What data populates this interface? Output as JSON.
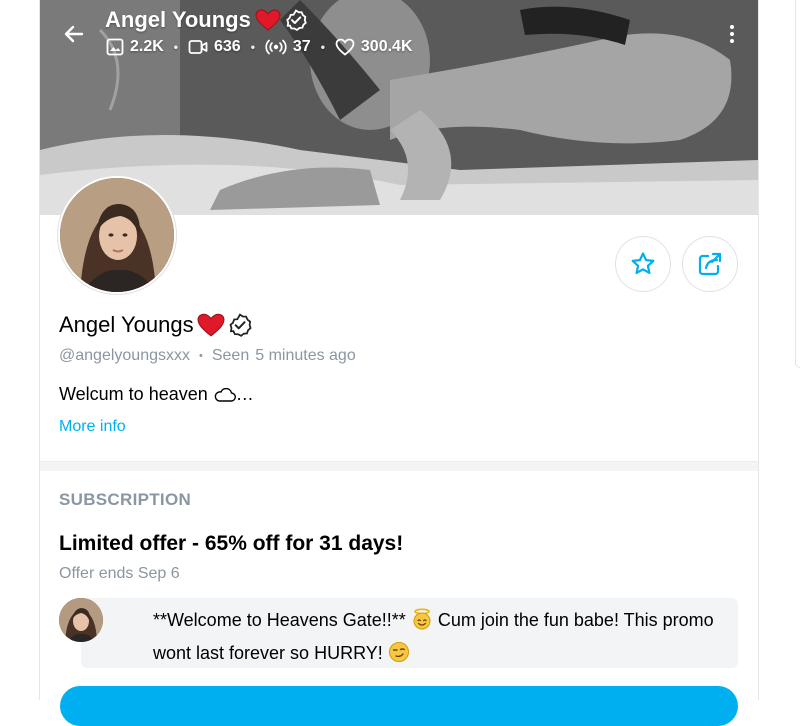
{
  "header": {
    "name": "Angel Youngs",
    "stats": [
      {
        "icon": "image-icon",
        "value": "2.2K"
      },
      {
        "icon": "video-icon",
        "value": "636"
      },
      {
        "icon": "stream-icon",
        "value": "37"
      },
      {
        "icon": "heart-outline-icon",
        "value": "300.4K"
      }
    ]
  },
  "profile": {
    "name": "Angel Youngs",
    "username": "@angelyoungsxxx",
    "seen_label": "Seen",
    "seen_value": "5 minutes ago",
    "bio": "Welcum to heaven",
    "bio_ellipsis": "…",
    "more_info": "More info"
  },
  "subscription": {
    "section_title": "SUBSCRIPTION",
    "offer_title": "Limited offer - 65% off for 31 days!",
    "offer_ends": "Offer ends Sep 6",
    "message_part1": "**Welcome to Heavens Gate!!**",
    "message_part2": "Cum join the fun babe! This promo wont last forever so HURRY!"
  },
  "colors": {
    "accent": "#00aff0",
    "muted": "#8a96a3",
    "heart": "#e0192a"
  }
}
